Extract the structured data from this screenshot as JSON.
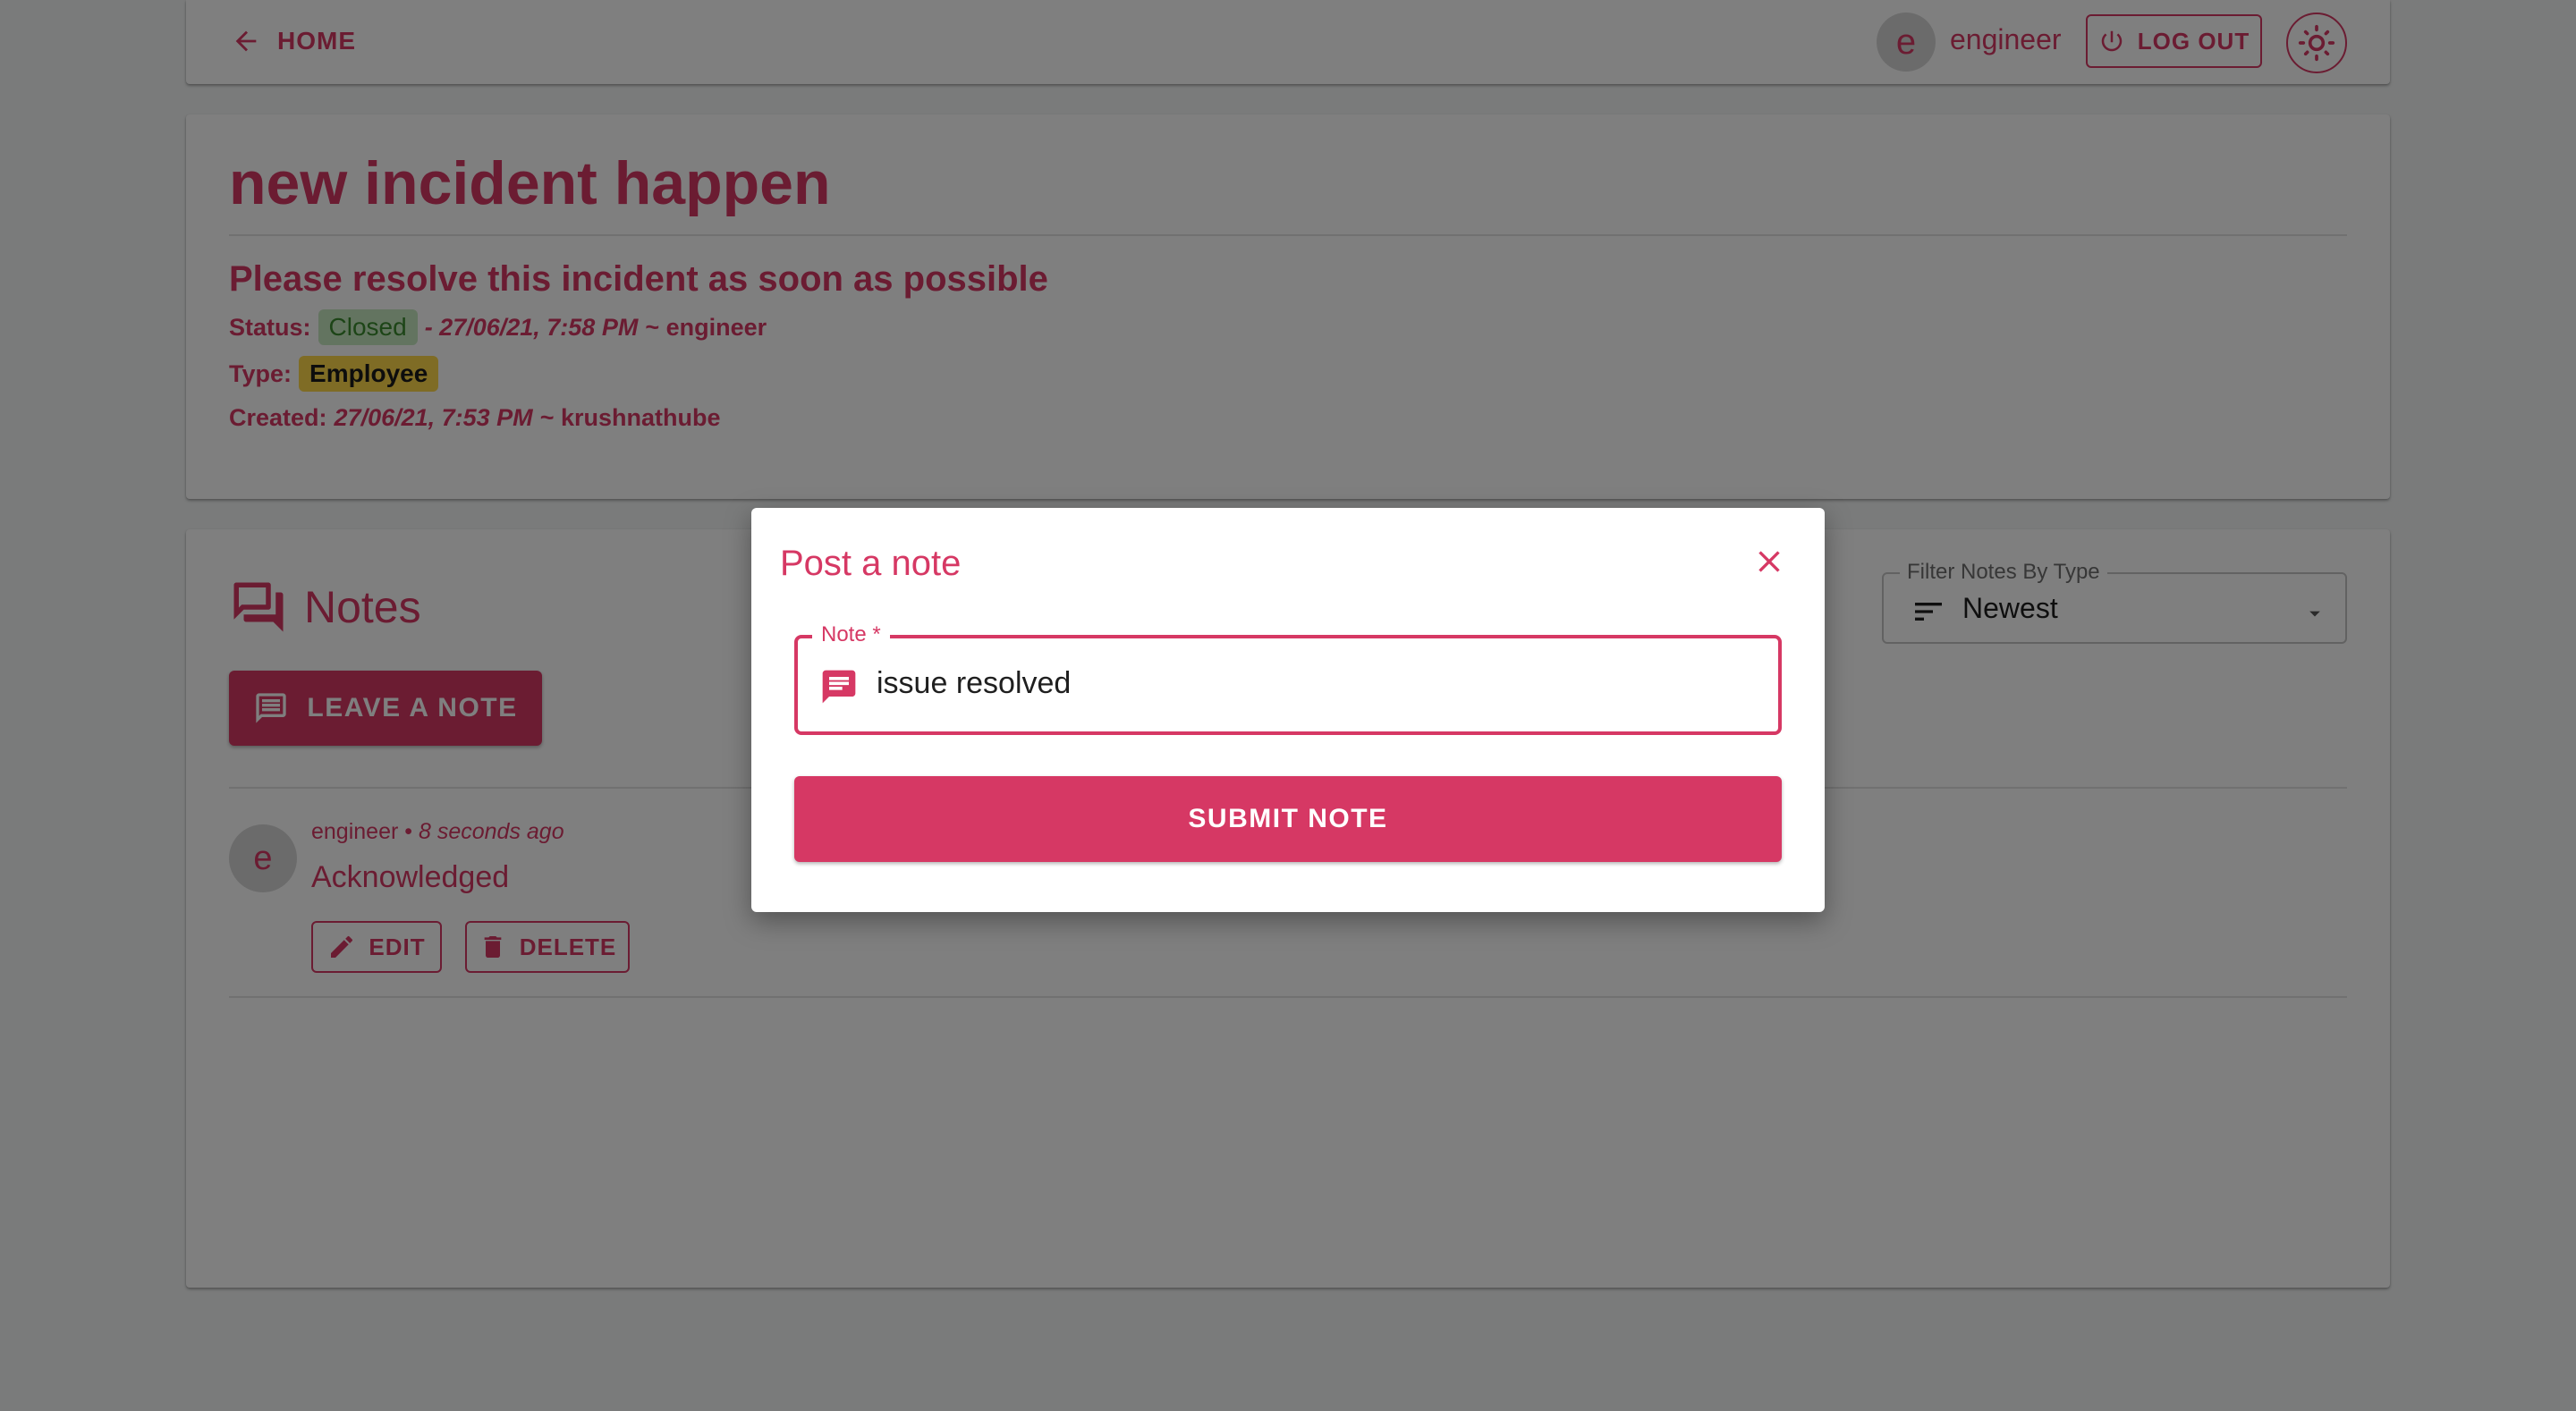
{
  "colors": {
    "accent": "#d63864",
    "backdrop": "rgba(0,0,0,0.5)",
    "closed_chip": "#c7e8c1",
    "employee_chip": "#ffd84a"
  },
  "topbar": {
    "home_label": "HOME",
    "avatar_letter": "e",
    "username": "engineer",
    "logout_label": "LOG OUT"
  },
  "incident": {
    "title": "new incident happen",
    "description": "Please resolve this incident as soon as possible",
    "status_label": "Status:",
    "status_value": "Closed",
    "status_time": "- 27/06/21, 7:58 PM",
    "status_by": "~ engineer",
    "type_label": "Type:",
    "type_value": "Employee",
    "created_label": "Created:",
    "created_time": "27/06/21, 7:53 PM",
    "created_by": "~ krushnathube"
  },
  "notes": {
    "title": "Notes",
    "leave_note_label": "LEAVE A NOTE",
    "filter_label": "Filter Notes By Type",
    "filter_value": "Newest",
    "items": [
      {
        "avatar_letter": "e",
        "author": "engineer",
        "separator": "•",
        "time": "8 seconds ago",
        "text": "Acknowledged",
        "edit_label": "EDIT",
        "delete_label": "DELETE"
      }
    ]
  },
  "dialog": {
    "title": "Post a note",
    "field_label": "Note *",
    "field_value": "issue resolved",
    "submit_label": "SUBMIT NOTE"
  }
}
